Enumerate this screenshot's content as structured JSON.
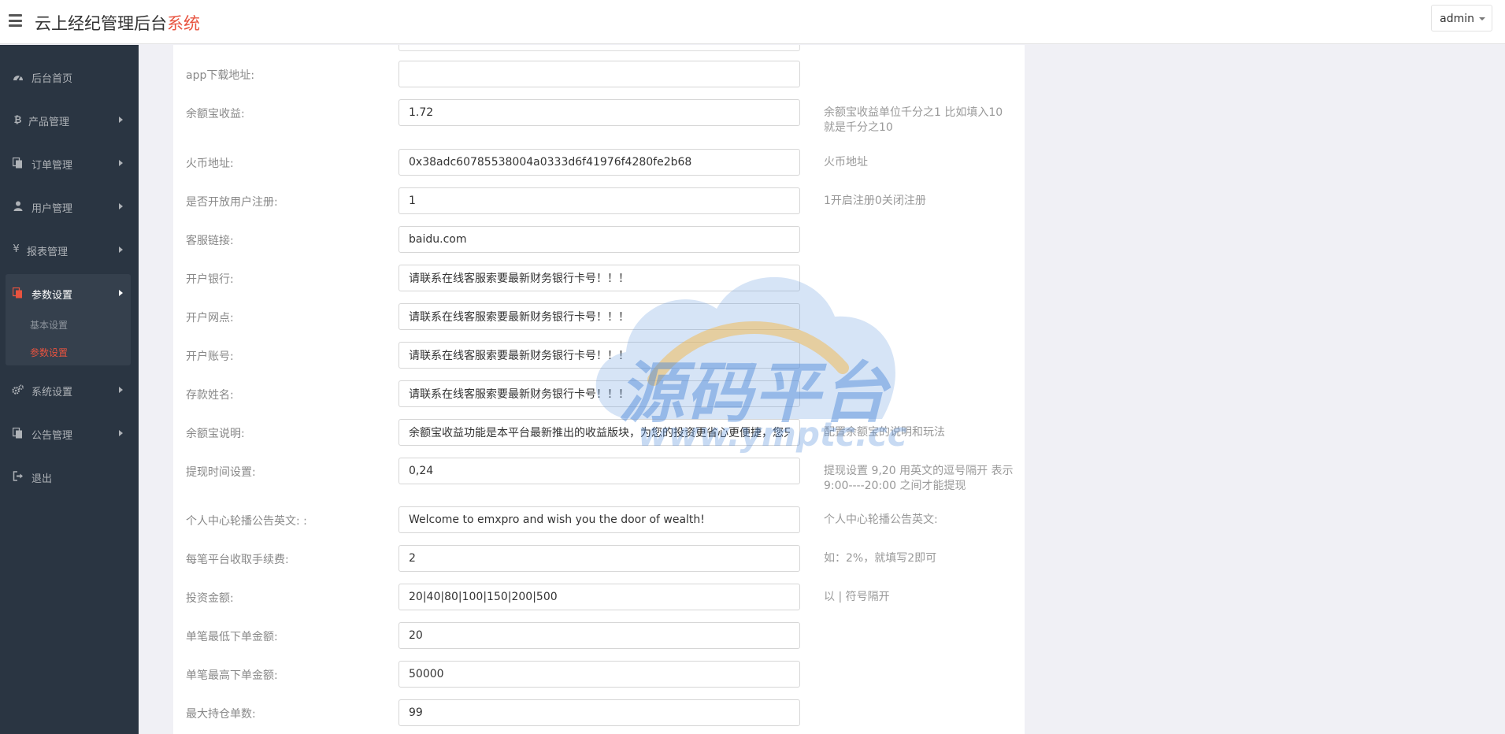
{
  "header": {
    "title_main": "云上经纪管理后台",
    "title_accent": "系统",
    "user": "admin"
  },
  "sidebar": {
    "items": [
      {
        "label": "后台首页",
        "icon": "dashboard-icon"
      },
      {
        "label": "产品管理",
        "icon": "bitcoin-icon"
      },
      {
        "label": "订单管理",
        "icon": "copy-icon"
      },
      {
        "label": "用户管理",
        "icon": "user-icon"
      },
      {
        "label": "报表管理",
        "icon": "yen-icon"
      },
      {
        "label": "参数设置",
        "icon": "copy-icon"
      },
      {
        "label": "系统设置",
        "icon": "gears-icon"
      },
      {
        "label": "公告管理",
        "icon": "copy-icon"
      },
      {
        "label": "退出",
        "icon": "sign-out-icon"
      }
    ],
    "sub_items": [
      "基本设置",
      "参数设置"
    ]
  },
  "form": {
    "rows": [
      {
        "label": "app下载地址:",
        "value": "",
        "help": ""
      },
      {
        "label": "余额宝收益:",
        "value": "1.72",
        "help": "余额宝收益单位千分之1 比如填入10 就是千分之10"
      },
      {
        "label": "火币地址:",
        "value": "0x38adc60785538004a0333d6f41976f4280fe2b68",
        "help": "火币地址"
      },
      {
        "label": "是否开放用户注册:",
        "value": "1",
        "help": "1开启注册0关闭注册"
      },
      {
        "label": "客服链接:",
        "value": "baidu.com",
        "help": ""
      },
      {
        "label": "开户银行:",
        "value": "请联系在线客服索要最新财务银行卡号！！！",
        "help": ""
      },
      {
        "label": "开户网点:",
        "value": "请联系在线客服索要最新财务银行卡号！！！",
        "help": ""
      },
      {
        "label": "开户账号:",
        "value": "请联系在线客服索要最新财务银行卡号！！！",
        "help": ""
      },
      {
        "label": "存款姓名:",
        "value": "请联系在线客服索要最新财务银行卡号！！！",
        "help": ""
      },
      {
        "label": "余额宝说明:",
        "value": "余额宝收益功能是本平台最新推出的收益版块，为您的投资更省心更便捷，您只",
        "help": "配置余额宝的说明和玩法"
      },
      {
        "label": "提现时间设置:",
        "value": "0,24",
        "help": "提现设置 9,20 用英文的逗号隔开 表示9:00----20:00 之间才能提现"
      },
      {
        "label": "个人中心轮播公告英文: :",
        "value": "Welcome to emxpro and wish you the door of wealth!",
        "help": "个人中心轮播公告英文:"
      },
      {
        "label": "每笔平台收取手续费:",
        "value": "2",
        "help": "如：2%，就填写2即可"
      },
      {
        "label": "投资金额:",
        "value": "20|40|80|100|150|200|500",
        "help": "以 | 符号隔开"
      },
      {
        "label": "单笔最低下单金额:",
        "value": "20",
        "help": ""
      },
      {
        "label": "单笔最高下单金额:",
        "value": "50000",
        "help": ""
      },
      {
        "label": "最大持仓单数:",
        "value": "99",
        "help": ""
      }
    ]
  },
  "watermark": {
    "text": "源码平台",
    "url": "www.ymptc.cc"
  },
  "colors": {
    "accent": "#e8533f",
    "sidebar_bg": "#2a3542",
    "sidebar_active": "#35404d",
    "page_bg": "#f0f0f5"
  }
}
